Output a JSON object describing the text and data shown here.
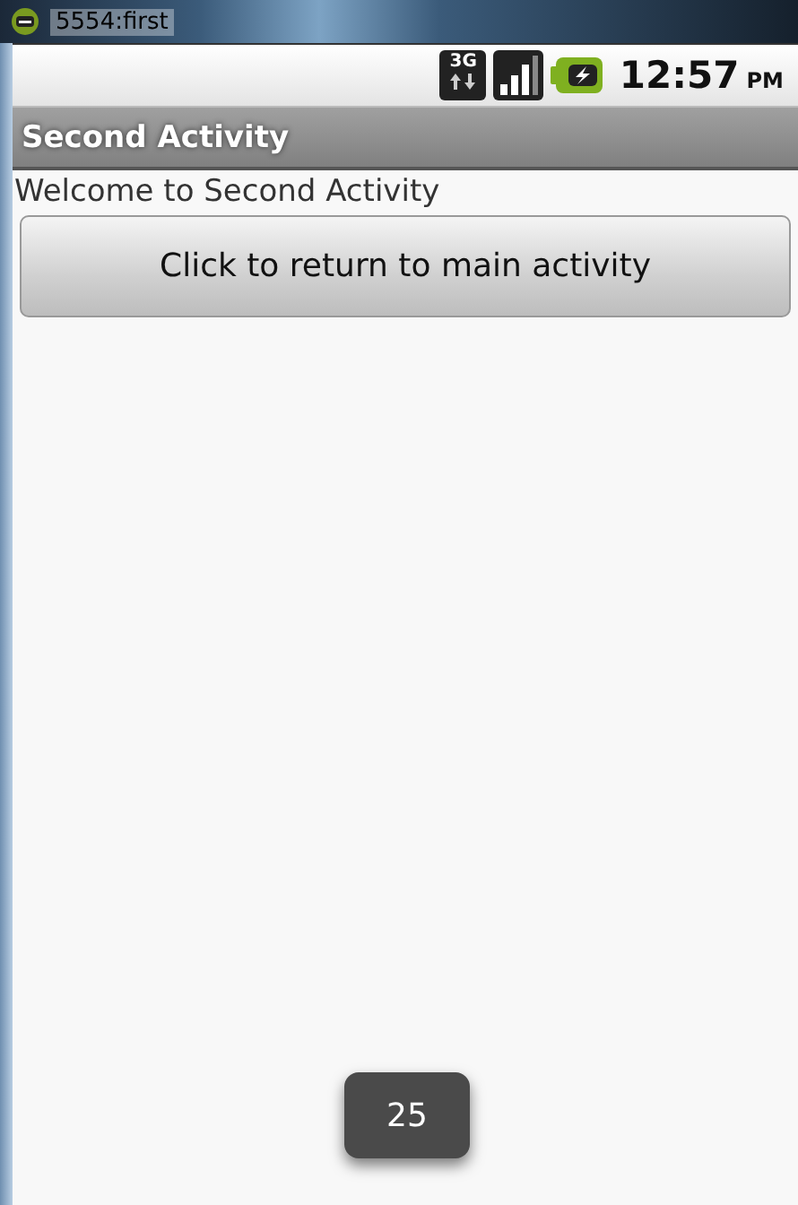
{
  "window": {
    "title": "5554:first"
  },
  "status_bar": {
    "network_type": "3G",
    "time": "12:57",
    "meridiem": "PM"
  },
  "action_bar": {
    "title": "Second Activity"
  },
  "content": {
    "text": "Welcome to Second Activity",
    "button": "Click to return to main activity"
  },
  "toast": {
    "text": "25"
  }
}
